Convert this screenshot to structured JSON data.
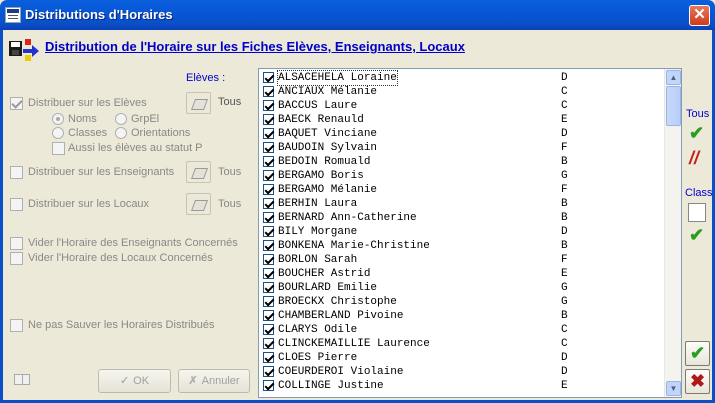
{
  "window": {
    "title": "Distributions d'Horaires",
    "close_label": "✕"
  },
  "header": {
    "title": "Distribution de l'Horaire sur les Fiches Elèves, Enseignants, Locaux"
  },
  "left": {
    "eleves_label": "Elèves :",
    "distribuer_eleves": "Distribuer sur les Elèves",
    "tous1": "Tous",
    "radio_noms": "Noms",
    "radio_grpel": "GrpEl",
    "radio_classes": "Classes",
    "radio_orientations": "Orientations",
    "aussi_statut": "Aussi les élèves au statut P",
    "distribuer_enseignants": "Distribuer sur les Enseignants",
    "tous2": "Tous",
    "distribuer_locaux": "Distribuer sur les Locaux",
    "tous3": "Tous",
    "vider_enseignants": "Vider l'Horaire des Enseignants Concernés",
    "vider_locaux": "Vider l'Horaire des Locaux Concernés",
    "ne_pas_sauver": "Ne pas Sauver les Horaires Distribués",
    "ok_label": "OK",
    "annuler_label": "Annuler"
  },
  "right": {
    "tous_label": "Tous",
    "class_label": "Class",
    "ok_icon": "✔",
    "cancel_icon": "✖"
  },
  "students": [
    {
      "name": "ALSACEHELA Loraine",
      "cls": "D"
    },
    {
      "name": "ANCIAUX Mélanie",
      "cls": "C"
    },
    {
      "name": "BACCUS Laure",
      "cls": "C"
    },
    {
      "name": "BAECK Renauld",
      "cls": "E"
    },
    {
      "name": "BAQUET Vinciane",
      "cls": "D"
    },
    {
      "name": "BAUDOIN Sylvain",
      "cls": "F"
    },
    {
      "name": "BEDOIN Romuald",
      "cls": "B"
    },
    {
      "name": "BERGAMO Boris",
      "cls": "G"
    },
    {
      "name": "BERGAMO Mélanie",
      "cls": "F"
    },
    {
      "name": "BERHIN Laura",
      "cls": "B"
    },
    {
      "name": "BERNARD Ann-Catherine",
      "cls": "B"
    },
    {
      "name": "BILY Morgane",
      "cls": "D"
    },
    {
      "name": "BONKENA Marie-Christine",
      "cls": "B"
    },
    {
      "name": "BORLON Sarah",
      "cls": "F"
    },
    {
      "name": "BOUCHER Astrid",
      "cls": "E"
    },
    {
      "name": "BOURLARD Emilie",
      "cls": "G"
    },
    {
      "name": "BROECKX Christophe",
      "cls": "G"
    },
    {
      "name": "CHAMBERLAND Pivoine",
      "cls": "B"
    },
    {
      "name": "CLARYS Odile",
      "cls": "C"
    },
    {
      "name": "CLINCKEMAILLIE Laurence",
      "cls": "C"
    },
    {
      "name": "CLOES Pierre",
      "cls": "D"
    },
    {
      "name": "COEURDEROI Violaine",
      "cls": "D"
    },
    {
      "name": "COLLINGE Justine",
      "cls": "E"
    }
  ]
}
